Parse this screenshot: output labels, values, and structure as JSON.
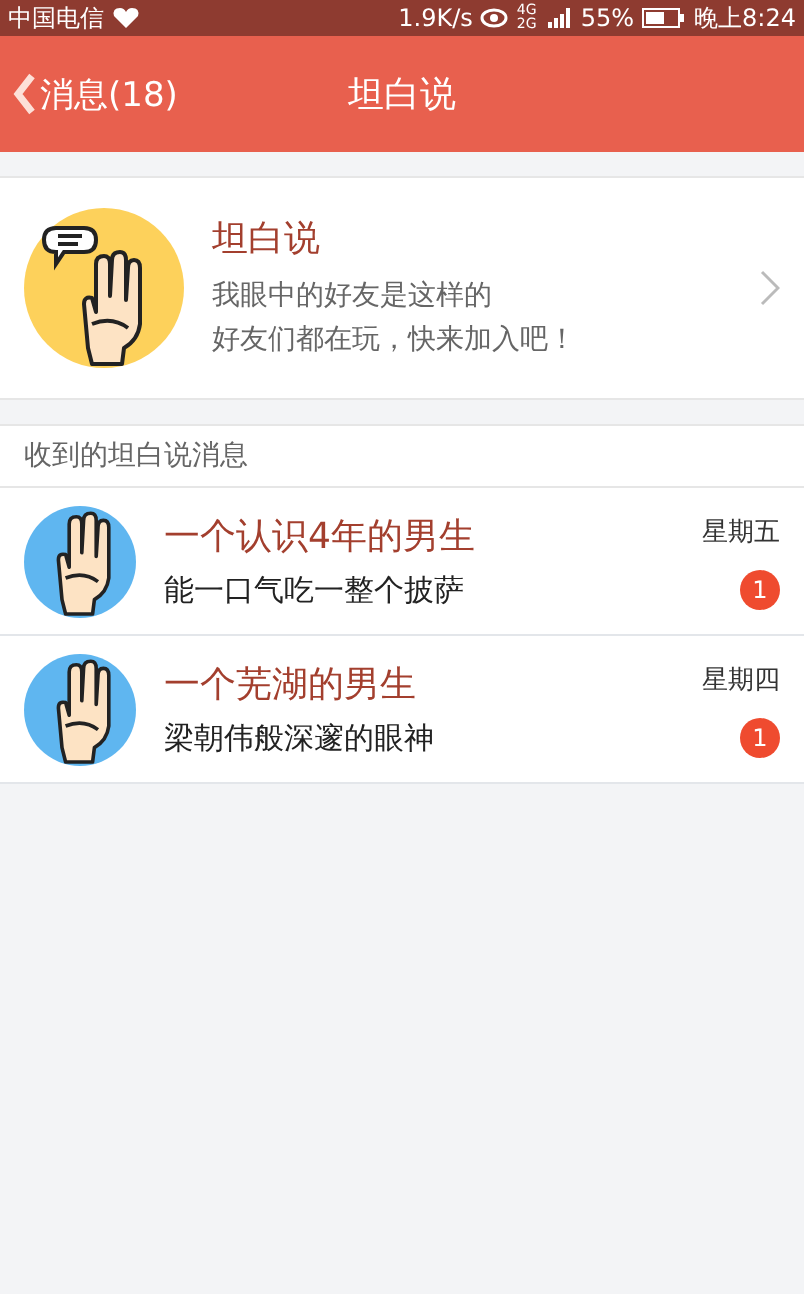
{
  "status_bar": {
    "carrier": "中国电信",
    "speed": "1.9K/s",
    "network": "4G 2G",
    "battery": "55%",
    "time": "晚上8:24"
  },
  "header": {
    "back": "消息(18)",
    "title": "坦白说"
  },
  "promo": {
    "title": "坦白说",
    "lines": [
      "我眼中的好友是这样的",
      "好友们都在玩，快来加入吧！"
    ]
  },
  "section_title": "收到的坦白说消息",
  "messages": [
    {
      "title": "一个认识4年的男生",
      "preview": "能一口气吃一整个披萨",
      "day": "星期五",
      "badge": "1"
    },
    {
      "title": "一个芜湖的男生",
      "preview": "梁朝伟般深邃的眼神",
      "day": "星期四",
      "badge": "1"
    }
  ]
}
